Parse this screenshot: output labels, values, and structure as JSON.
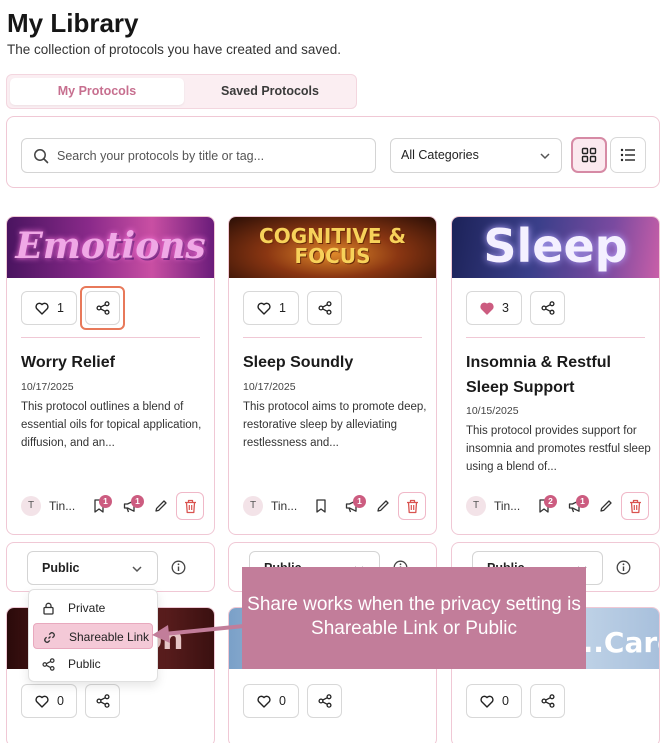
{
  "page": {
    "title": "My Library",
    "subtitle": "The collection of protocols you have created and saved."
  },
  "tabs": [
    {
      "label": "My Protocols",
      "active": true
    },
    {
      "label": "Saved Protocols",
      "active": false
    }
  ],
  "search": {
    "placeholder": "Search your protocols by title or tag...",
    "icon": "search-icon"
  },
  "category_select": {
    "value": "All Categories"
  },
  "view_toggle": {
    "active": "grid"
  },
  "cards": [
    {
      "banner": "Emotions",
      "banner_colors": [
        "#5a1a6e",
        "#c94fa3"
      ],
      "likes": "1",
      "liked": false,
      "title": "Worry Relief",
      "date": "10/17/2025",
      "description": "This protocol outlines a blend of essential oils for topical application, diffusion, and an...",
      "author": "Tin...",
      "avatar": "T",
      "save_count": "1",
      "comment_count": "1",
      "privacy": "Public"
    },
    {
      "banner": "COGNITIVE & FOCUS",
      "banner_colors": [
        "#3a1208",
        "#c8641c"
      ],
      "likes": "1",
      "liked": false,
      "title": "Sleep Soundly",
      "date": "10/17/2025",
      "description": "This protocol aims to promote deep, restorative sleep by alleviating restlessness and...",
      "author": "Tin...",
      "avatar": "T",
      "save_count": "",
      "comment_count": "1",
      "privacy": "Public"
    },
    {
      "banner": "Sleep",
      "banner_colors": [
        "#2a2f6e",
        "#c95fa8"
      ],
      "likes": "3",
      "liked": true,
      "title": "Insomnia & Restful Sleep Support",
      "date": "10/15/2025",
      "description": "This protocol provides support for insomnia and promotes restful sleep using a blend of...",
      "author": "Tin...",
      "avatar": "T",
      "save_count": "2",
      "comment_count": "1",
      "privacy": "Public"
    }
  ],
  "privacy_options": [
    {
      "label": "Private",
      "icon": "lock-icon"
    },
    {
      "label": "Shareable Link",
      "icon": "link-icon",
      "selected": true
    },
    {
      "label": "Public",
      "icon": "share-icon"
    }
  ],
  "second_row": [
    {
      "banner": "...ion",
      "likes": "0"
    },
    {
      "banner": "",
      "likes": "0"
    },
    {
      "banner": "...Care",
      "likes": "0"
    }
  ],
  "callout": {
    "text": "Share works when the privacy setting is Shareable Link or Public"
  },
  "colors": {
    "accent": "#c76f8f",
    "border": "#f0c8d5",
    "highlight": "#e8795a",
    "callout": "#c27d9a",
    "badge": "#cc5c80"
  }
}
